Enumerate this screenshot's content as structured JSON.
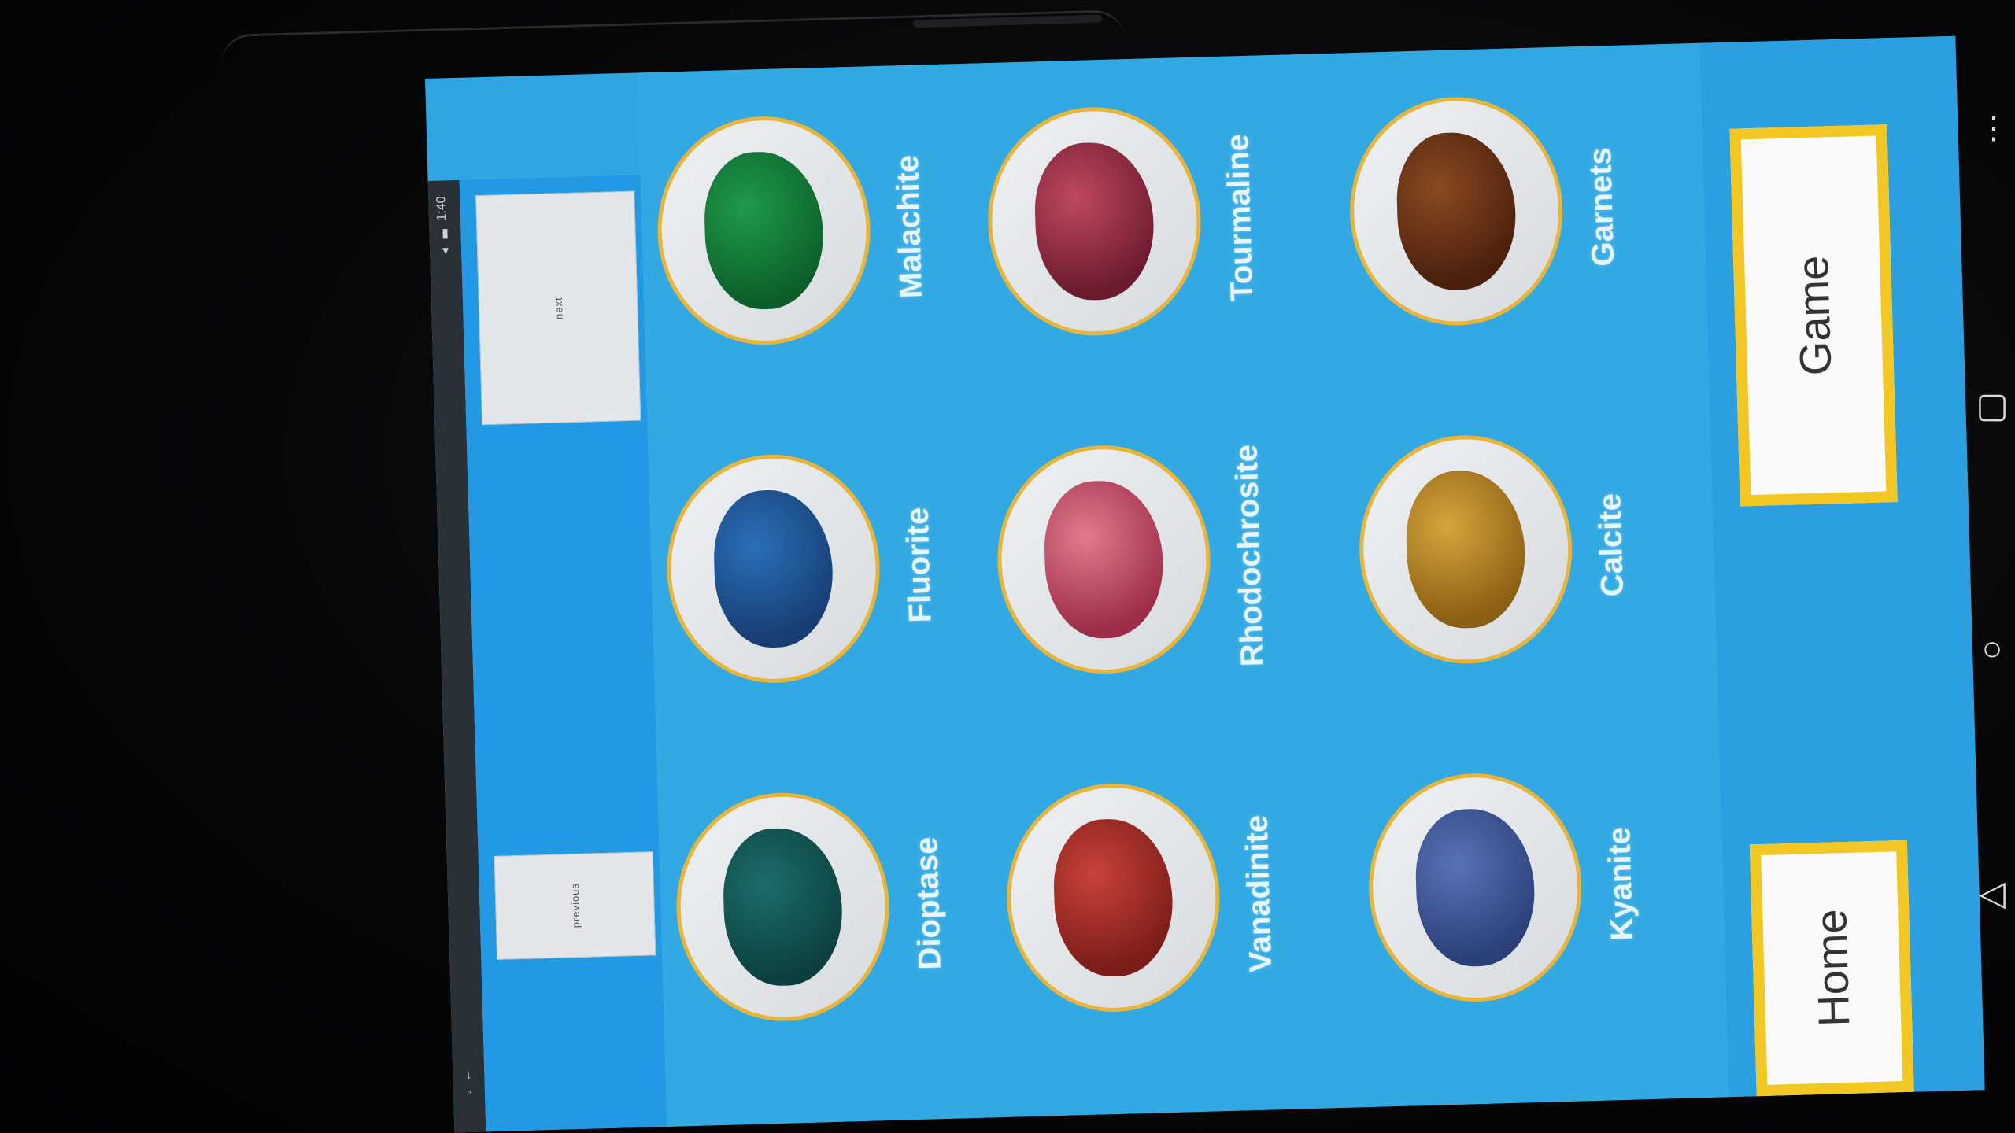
{
  "status_bar": {
    "time": "1:40",
    "icons": [
      "wifi-icon",
      "battery-icon"
    ],
    "bottom_icons": [
      "notification-icon",
      "download-icon"
    ]
  },
  "nav": {
    "next_label": "next",
    "previous_label": "previous"
  },
  "minerals": [
    {
      "name": "Malachite",
      "color_main": "#1f9a4a",
      "color_dark": "#0b5e2a"
    },
    {
      "name": "Fluorite",
      "color_main": "#2a6fb8",
      "color_dark": "#173d72"
    },
    {
      "name": "Dioptase",
      "color_main": "#1c6d6a",
      "color_dark": "#0c3f3d"
    },
    {
      "name": "Tourmaline",
      "color_main": "#c0485f",
      "color_dark": "#6a1b2e"
    },
    {
      "name": "Rhodochrosite",
      "color_main": "#e07b8d",
      "color_dark": "#9c2c47"
    },
    {
      "name": "Vanadinite",
      "color_main": "#c84238",
      "color_dark": "#7a1c18"
    },
    {
      "name": "Garnets",
      "color_main": "#8a4a22",
      "color_dark": "#4a1f0c"
    },
    {
      "name": "Calcite",
      "color_main": "#d6a53a",
      "color_dark": "#8a5e14"
    },
    {
      "name": "Kyanite",
      "color_main": "#5873b8",
      "color_dark": "#2b3f78"
    }
  ],
  "actions": {
    "game_label": "Game",
    "home_label": "Home"
  },
  "system_nav": [
    "menu-icon",
    "recents-icon",
    "home-icon",
    "back-icon"
  ]
}
